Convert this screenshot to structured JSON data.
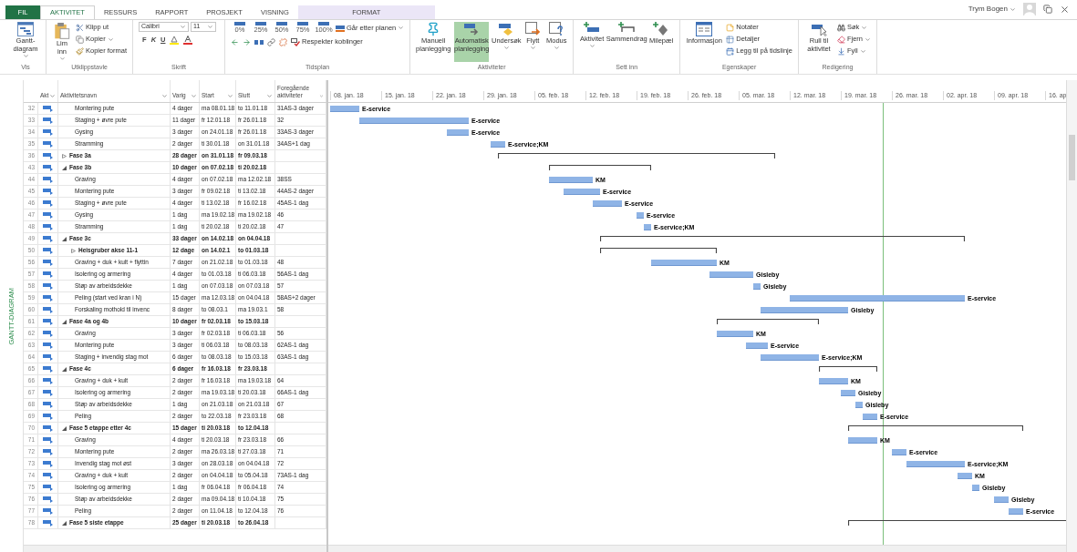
{
  "tabs": [
    {
      "label": "FIL",
      "kind": "file",
      "selected": false
    },
    {
      "label": "AKTIVITET",
      "kind": "normal",
      "selected": true
    },
    {
      "label": "RESSURS",
      "kind": "normal",
      "selected": false
    },
    {
      "label": "RAPPORT",
      "kind": "normal",
      "selected": false
    },
    {
      "label": "PROSJEKT",
      "kind": "normal",
      "selected": false
    },
    {
      "label": "VISNING",
      "kind": "normal",
      "selected": false
    },
    {
      "label": "FORMAT",
      "kind": "contextual",
      "selected": false
    }
  ],
  "user": {
    "name": "Trym Bogen"
  },
  "ribbon": {
    "vis": {
      "label": "Vis",
      "items": [
        "Gantt-diagram"
      ]
    },
    "clipboard": {
      "label": "Utklippstavle",
      "items": [
        "Lim inn",
        "Klipp ut",
        "Kopier",
        "Kopier format"
      ]
    },
    "font": {
      "label": "Skrift",
      "family": "Calibri",
      "size": "11",
      "styles": [
        "F",
        "K",
        "U"
      ]
    },
    "schedule": {
      "label": "Tidsplan",
      "progress": [
        "0%",
        "25%",
        "50%",
        "75%",
        "100%"
      ],
      "items": [
        "Går etter planen",
        "Respekter koblinger"
      ]
    },
    "tasks": {
      "label": "Aktiviteter",
      "modes": [
        {
          "label": "Manuell planlegging",
          "selected": false
        },
        {
          "label": "Automatisk planlegging",
          "selected": true
        }
      ],
      "items": [
        "Undersøk",
        "Flytt",
        "Modus"
      ]
    },
    "insert": {
      "label": "Sett inn",
      "items": [
        "Aktivitet",
        "Sammendrag",
        "Milepæl"
      ]
    },
    "properties": {
      "label": "Egenskaper",
      "items": [
        "Informasjon",
        "Notater",
        "Detaljer",
        "Legg til på tidslinje"
      ]
    },
    "editing": {
      "label": "Redigering",
      "items": [
        "Rull til aktivitet",
        "Søk",
        "Fjern",
        "Fyll"
      ]
    }
  },
  "view_label": "GANTT-DIAGRAM",
  "columns": [
    "Akt",
    "Aktivitetsnavn",
    "Varig",
    "Start",
    "Slutt",
    "Foregående aktiviteter"
  ],
  "timescale": {
    "ticks": [
      "08. jan. 18",
      "15. jan. 18",
      "22. jan. 18",
      "29. jan. 18",
      "05. feb. 18",
      "12. feb. 18",
      "19. feb. 18",
      "26. feb. 18",
      "05. mar. 18",
      "12. mar. 18",
      "19. mar. 18",
      "26. mar. 18",
      "02. apr. 18",
      "09. apr. 18",
      "16. ap"
    ]
  },
  "tasks": [
    {
      "id": "32",
      "kind": "task",
      "name": "Montering pute",
      "duration": "4 dager",
      "start": "ma 08.01.18",
      "finish": "to 11.01.18",
      "predecessors": "31AS-3 dager",
      "resources": "E-service"
    },
    {
      "id": "33",
      "kind": "task",
      "name": "Staging + øvre pute",
      "duration": "11 dager",
      "start": "fr 12.01.18",
      "finish": "fr 26.01.18",
      "predecessors": "32",
      "resources": "E-service"
    },
    {
      "id": "34",
      "kind": "task",
      "name": "Gysing",
      "duration": "3 dager",
      "start": "on 24.01.18",
      "finish": "fr 26.01.18",
      "predecessors": "33AS-3 dager",
      "resources": "E-service"
    },
    {
      "id": "35",
      "kind": "task",
      "name": "Stramming",
      "duration": "2 dager",
      "start": "ti 30.01.18",
      "finish": "on 31.01.18",
      "predecessors": "34AS+1 dag",
      "resources": "E-service;KM"
    },
    {
      "id": "36",
      "kind": "summary",
      "expanded": false,
      "name": "Fase 3a",
      "duration": "28 dager",
      "start": "on 31.01.18",
      "finish": "fr 09.03.18"
    },
    {
      "id": "43",
      "kind": "summary",
      "expanded": true,
      "name": "Fase 3b",
      "duration": "10 dager",
      "start": "on 07.02.18",
      "finish": "ti 20.02.18",
      "children": [
        {
          "id": "44",
          "kind": "task",
          "name": "Graving",
          "duration": "4 dager",
          "start": "on 07.02.18",
          "finish": "ma 12.02.18",
          "predecessors": "38SS",
          "resources": "KM"
        },
        {
          "id": "45",
          "kind": "task",
          "name": "Montering pute",
          "duration": "3 dager",
          "start": "fr 09.02.18",
          "finish": "ti 13.02.18",
          "predecessors": "44AS-2 dager",
          "resources": "E-service"
        },
        {
          "id": "46",
          "kind": "task",
          "name": "Staging + øvre pute",
          "duration": "4 dager",
          "start": "ti 13.02.18",
          "finish": "fr 16.02.18",
          "predecessors": "45AS-1 dag",
          "resources": "E-service"
        },
        {
          "id": "47",
          "kind": "task",
          "name": "Gysing",
          "duration": "1 dag",
          "start": "ma 19.02.18",
          "finish": "ma 19.02.18",
          "predecessors": "46",
          "resources": "E-service"
        },
        {
          "id": "48",
          "kind": "task",
          "name": "Stramming",
          "duration": "1 dag",
          "start": "ti 20.02.18",
          "finish": "ti 20.02.18",
          "predecessors": "47",
          "resources": "E-service;KM"
        }
      ]
    },
    {
      "id": "49",
      "kind": "summary",
      "expanded": true,
      "name": "Fase 3c",
      "duration": "33 dager",
      "start": "on 14.02.18",
      "finish": "on 04.04.18",
      "children": [
        {
          "id": "50",
          "kind": "summary",
          "expanded": false,
          "name": "Heisgruber akse 11-1",
          "duration": "12 dage",
          "start": "on 14.02.1",
          "finish": "to 01.03.18"
        },
        {
          "id": "56",
          "kind": "task",
          "name": "Graving + duk + kult + flyttin",
          "duration": "7 dager",
          "start": "on 21.02.18",
          "finish": "to 01.03.18",
          "predecessors": "48",
          "resources": "KM"
        },
        {
          "id": "57",
          "kind": "task",
          "name": "Isolering og armering",
          "duration": "4 dager",
          "start": "to 01.03.18",
          "finish": "ti 06.03.18",
          "predecessors": "56AS-1 dag",
          "resources": "Gisleby"
        },
        {
          "id": "58",
          "kind": "task",
          "name": "Støp av arbeidsdekke",
          "duration": "1 dag",
          "start": "on 07.03.18",
          "finish": "on 07.03.18",
          "predecessors": "57",
          "resources": "Gisleby"
        },
        {
          "id": "59",
          "kind": "task",
          "name": "Peling (start ved kran i N)",
          "duration": "15 dager",
          "start": "ma 12.03.18",
          "finish": "on 04.04.18",
          "predecessors": "58AS+2 dager",
          "resources": "E-service"
        },
        {
          "id": "60",
          "kind": "task",
          "name": "Forskaling mothold til invenc",
          "duration": "8 dager",
          "start": "to 08.03.1",
          "finish": "ma 19.03.1",
          "predecessors": "58",
          "resources": "Gisleby"
        }
      ]
    },
    {
      "id": "61",
      "kind": "summary",
      "expanded": true,
      "name": "Fase 4a og 4b",
      "duration": "10 dager",
      "start": "fr 02.03.18",
      "finish": "to 15.03.18",
      "children": [
        {
          "id": "62",
          "kind": "task",
          "name": "Graving",
          "duration": "3 dager",
          "start": "fr 02.03.18",
          "finish": "ti 06.03.18",
          "predecessors": "56",
          "resources": "KM"
        },
        {
          "id": "63",
          "kind": "task",
          "name": "Montering pute",
          "duration": "3 dager",
          "start": "ti 06.03.18",
          "finish": "to 08.03.18",
          "predecessors": "62AS-1 dag",
          "resources": "E-service"
        },
        {
          "id": "64",
          "kind": "task",
          "name": "Staging + invendig stag mot",
          "duration": "6 dager",
          "start": "to 08.03.18",
          "finish": "to 15.03.18",
          "predecessors": "63AS-1 dag",
          "resources": "E-service;KM"
        }
      ]
    },
    {
      "id": "65",
      "kind": "summary",
      "expanded": true,
      "name": "Fase 4c",
      "duration": "6 dager",
      "start": "fr 16.03.18",
      "finish": "fr 23.03.18",
      "children": [
        {
          "id": "66",
          "kind": "task",
          "name": "Graving + duk + kult",
          "duration": "2 dager",
          "start": "fr 16.03.18",
          "finish": "ma 19.03.18",
          "predecessors": "64",
          "resources": "KM"
        },
        {
          "id": "67",
          "kind": "task",
          "name": "Isolering og armering",
          "duration": "2 dager",
          "start": "ma 19.03.18",
          "finish": "ti 20.03.18",
          "predecessors": "66AS-1 dag",
          "resources": "Gisleby"
        },
        {
          "id": "68",
          "kind": "task",
          "name": "Støp av arbeidsdekke",
          "duration": "1 dag",
          "start": "on 21.03.18",
          "finish": "on 21.03.18",
          "predecessors": "67",
          "resources": "Gisleby"
        },
        {
          "id": "69",
          "kind": "task",
          "name": "Peling",
          "duration": "2 dager",
          "start": "to 22.03.18",
          "finish": "fr 23.03.18",
          "predecessors": "68",
          "resources": "E-service"
        }
      ]
    },
    {
      "id": "70",
      "kind": "summary",
      "expanded": true,
      "name": "Fase 5 etappe etter 4c",
      "duration": "15 dager",
      "start": "ti 20.03.18",
      "finish": "to 12.04.18",
      "children": [
        {
          "id": "71",
          "kind": "task",
          "name": "Graving",
          "duration": "4 dager",
          "start": "ti 20.03.18",
          "finish": "fr 23.03.18",
          "predecessors": "66",
          "resources": "KM"
        },
        {
          "id": "72",
          "kind": "task",
          "name": "Montering pute",
          "duration": "2 dager",
          "start": "ma 26.03.18",
          "finish": "ti 27.03.18",
          "predecessors": "71",
          "resources": "E-service"
        },
        {
          "id": "73",
          "kind": "task",
          "name": "Invendig stag mot øst",
          "duration": "3 dager",
          "start": "on 28.03.18",
          "finish": "on 04.04.18",
          "predecessors": "72",
          "resources": "E-service;KM"
        },
        {
          "id": "74",
          "kind": "task",
          "name": "Graving + duk + kult",
          "duration": "2 dager",
          "start": "on 04.04.18",
          "finish": "to 05.04.18",
          "predecessors": "73AS-1 dag",
          "resources": "KM"
        },
        {
          "id": "75",
          "kind": "task",
          "name": "Isolering og armering",
          "duration": "1 dag",
          "start": "fr 06.04.18",
          "finish": "fr 06.04.18",
          "predecessors": "74",
          "resources": "Gisleby"
        },
        {
          "id": "76",
          "kind": "task",
          "name": "Støp av arbeidsdekke",
          "duration": "2 dager",
          "start": "ma 09.04.18",
          "finish": "ti 10.04.18",
          "predecessors": "75",
          "resources": "Gisleby"
        },
        {
          "id": "77",
          "kind": "task",
          "name": "Peling",
          "duration": "2 dager",
          "start": "on 11.04.18",
          "finish": "to 12.04.18",
          "predecessors": "76",
          "resources": "E-service"
        }
      ]
    },
    {
      "id": "78",
      "kind": "summary",
      "expanded": true,
      "name": "Fase 5 siste etappe",
      "duration": "25 dager",
      "start": "ti 20.03.18",
      "finish": "to 26.04.18"
    }
  ]
}
